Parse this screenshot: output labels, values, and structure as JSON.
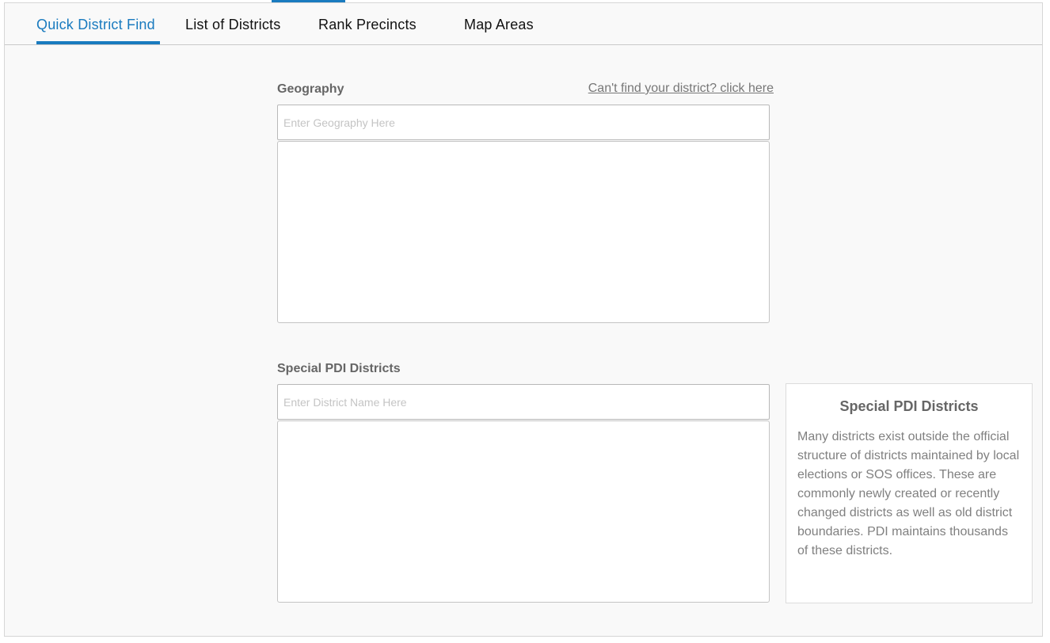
{
  "tabs": [
    {
      "label": "Quick District Find",
      "active": true
    },
    {
      "label": "List of Districts",
      "active": false
    },
    {
      "label": "Rank Precincts",
      "active": false
    },
    {
      "label": "Map Areas",
      "active": false
    }
  ],
  "geography": {
    "label": "Geography",
    "help_link": "Can't find your district? click here",
    "placeholder": "Enter Geography Here",
    "value": ""
  },
  "special": {
    "label": "Special PDI Districts",
    "placeholder": "Enter District Name Here",
    "value": ""
  },
  "info": {
    "title": "Special PDI Districts",
    "body": "Many districts exist outside the official structure of districts maintained by local elections or SOS offices. These are commonly newly created or recently changed districts as well as old district boundaries. PDI maintains thousands of these districts."
  },
  "colors": {
    "accent": "#1a7bbf",
    "label": "#666666",
    "muted_text": "#808080"
  }
}
